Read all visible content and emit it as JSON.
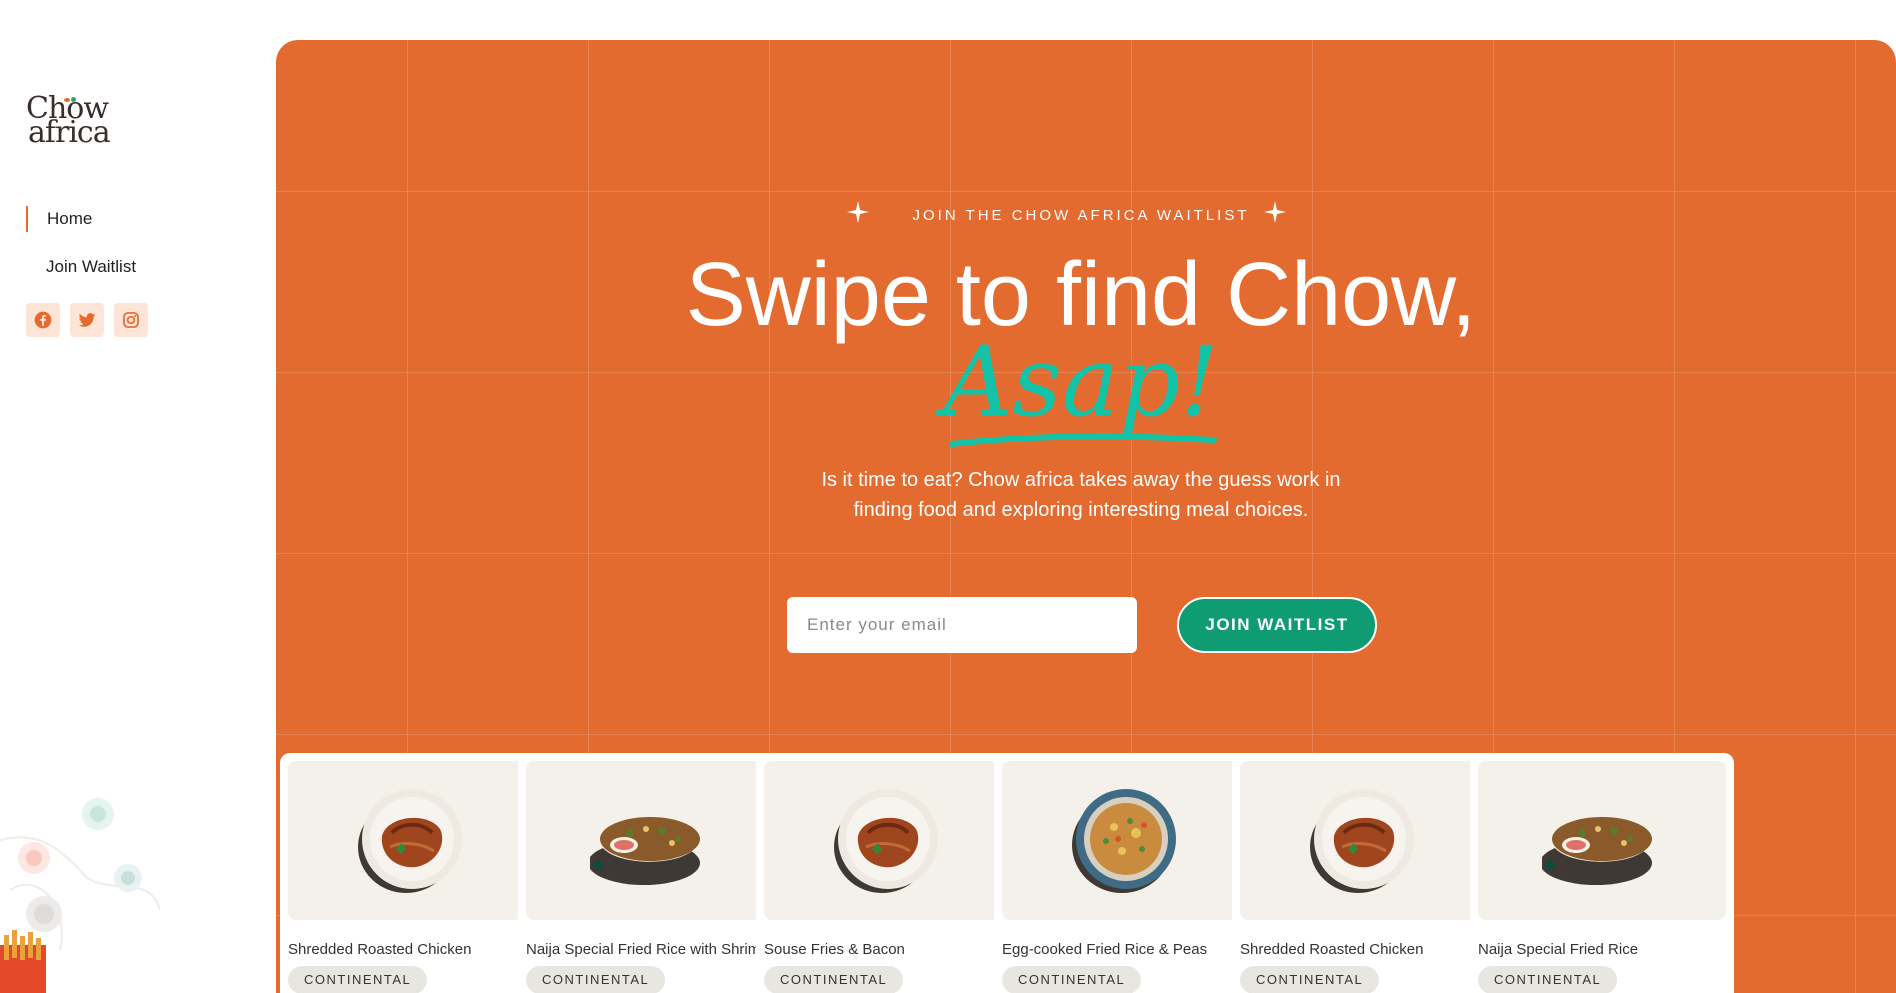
{
  "brand": {
    "line1": "Chow",
    "line2": "africa"
  },
  "nav": {
    "items": [
      {
        "label": "Home"
      },
      {
        "label": "Join Waitlist"
      }
    ]
  },
  "socials": [
    {
      "icon": "facebook-icon"
    },
    {
      "icon": "twitter-icon"
    },
    {
      "icon": "instagram-icon"
    }
  ],
  "hero": {
    "kicker": "JOIN THE CHOW AFRICA WAITLIST",
    "headline": "Swipe to find Chow,",
    "accent": "Asap!",
    "subtext": "Is it time to eat? Chow africa takes away the guess work in finding food and exploring interesting meal choices.",
    "email_placeholder": "Enter your email",
    "button_label": "JOIN WAITLIST"
  },
  "colors": {
    "primary": "#e46b2f",
    "accent": "#12c3a8",
    "button": "#0f9c72",
    "card_bg": "#f3f1ea"
  },
  "cards": [
    {
      "title": "Shredded Roasted Chicken",
      "tag": "CONTINENTAL",
      "dish": "chicken"
    },
    {
      "title": "Naija Special Fried Rice with Shrimps",
      "tag": "CONTINENTAL",
      "dish": "rice-bowl"
    },
    {
      "title": "Souse Fries & Bacon",
      "tag": "CONTINENTAL",
      "dish": "chicken"
    },
    {
      "title": "Egg-cooked Fried Rice & Peas",
      "tag": "CONTINENTAL",
      "dish": "fried-rice"
    },
    {
      "title": "Shredded Roasted Chicken",
      "tag": "CONTINENTAL",
      "dish": "chicken"
    },
    {
      "title": "Naija Special Fried Rice",
      "tag": "CONTINENTAL",
      "dish": "rice-bowl"
    }
  ]
}
